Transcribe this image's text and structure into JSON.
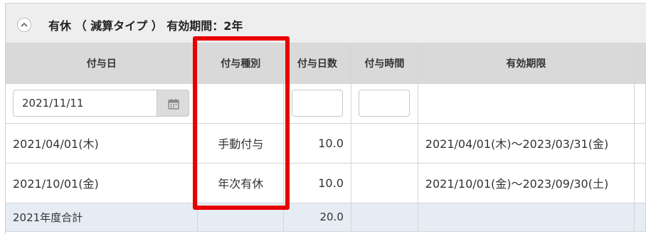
{
  "panel": {
    "title": "有休 （ 減算タイプ ） 有効期間：2年"
  },
  "table": {
    "headers": [
      "付与日",
      "付与種別",
      "付与日数",
      "付与時間",
      "有効期限"
    ],
    "input_row": {
      "date_value": "2021/11/11",
      "days_value": "",
      "hours_value": ""
    },
    "rows": [
      {
        "grant_date": "2021/04/01(木)",
        "grant_type": "手動付与",
        "days": "10.0",
        "hours": "",
        "expiry": "2021/04/01(木)～2023/03/31(金)"
      },
      {
        "grant_date": "2021/10/01(金)",
        "grant_type": "年次有休",
        "days": "10.0",
        "hours": "",
        "expiry": "2021/10/01(金)～2023/09/30(土)"
      }
    ],
    "total": {
      "label": "2021年度合計",
      "days": "20.0"
    }
  },
  "icons": {
    "collapse": "chevron-up-icon",
    "calendar": "calendar-icon"
  },
  "colors": {
    "highlight": "#e80000",
    "header_bg": "#d9d9d9",
    "total_bg": "#e6ecf3"
  }
}
